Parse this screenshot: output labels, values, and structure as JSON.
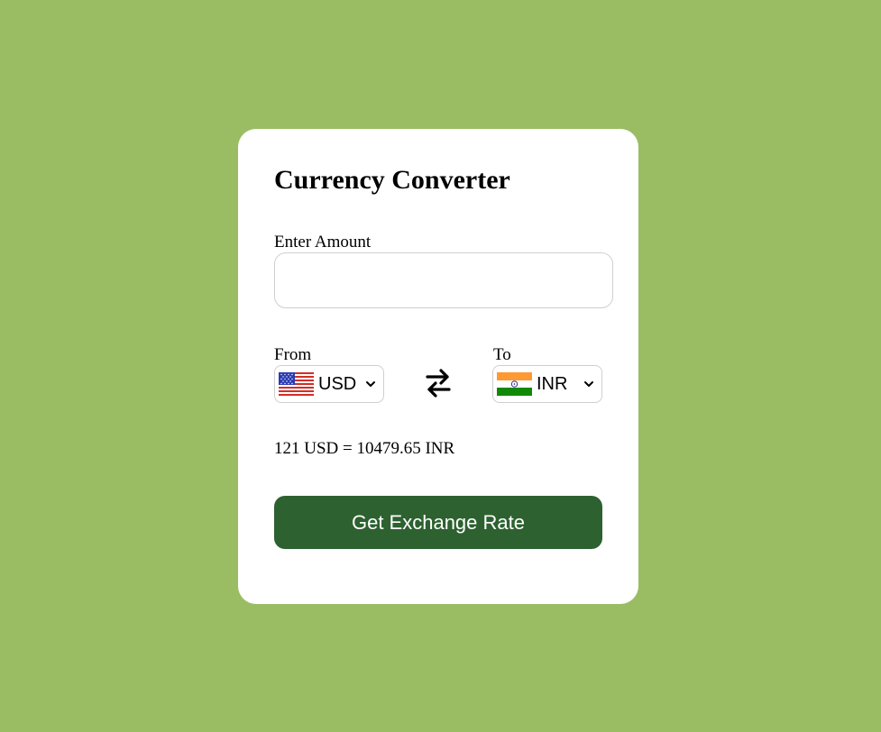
{
  "card": {
    "title": "Currency Converter",
    "amount_label": "Enter Amount",
    "amount_value": "",
    "amount_placeholder": "",
    "from_label": "From",
    "to_label": "To",
    "from": {
      "code": "USD",
      "flag_icon": "us-flag-icon"
    },
    "to": {
      "code": "INR",
      "flag_icon": "india-flag-icon"
    },
    "swap_icon": "swap-arrows-icon",
    "result_text": "121 USD = 10479.65 INR",
    "button_label": "Get Exchange Rate"
  },
  "colors": {
    "page_background": "#9abd64",
    "card_background": "#ffffff",
    "button_background": "#2d6130",
    "button_text": "#ffffff",
    "input_border": "#cfcfcf"
  }
}
